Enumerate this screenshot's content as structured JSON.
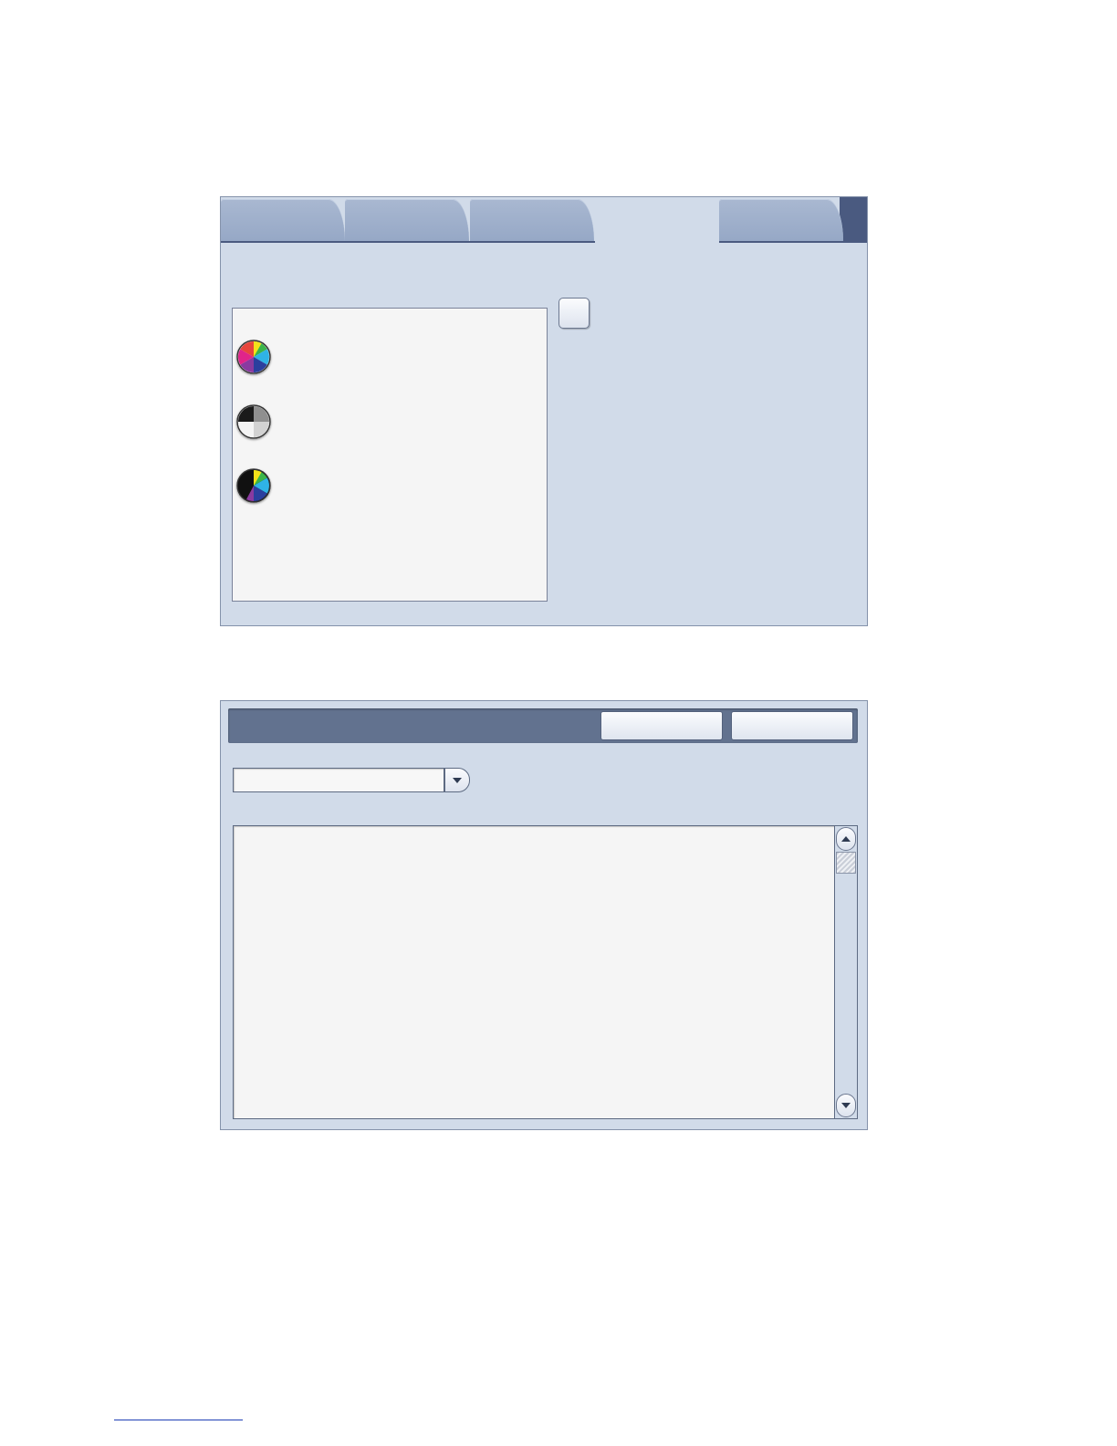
{
  "panel_tabs": {
    "tabs": [
      {
        "label": "",
        "active": false
      },
      {
        "label": "",
        "active": false
      },
      {
        "label": "",
        "active": false
      },
      {
        "label": "",
        "active": true
      },
      {
        "label": "",
        "active": false
      }
    ],
    "color_options": [
      {
        "label": "",
        "icon": "full-color-wheel-icon"
      },
      {
        "label": "",
        "icon": "grayscale-wheel-icon"
      },
      {
        "label": "",
        "icon": "black-color-wheel-icon"
      }
    ],
    "checkbox_label": ""
  },
  "panel_dialog": {
    "header_title": "",
    "header_buttons": [
      "",
      ""
    ],
    "dropdown_value": "",
    "list_items": []
  },
  "colors": {
    "panel_bg": "#d1dbe9",
    "tab_bg": "#a9b8d1",
    "header_bg": "#62728f",
    "tab_bar_accent": "#4a5a80",
    "list_bg": "#f5f5f5",
    "link": "#1f3fb5"
  }
}
